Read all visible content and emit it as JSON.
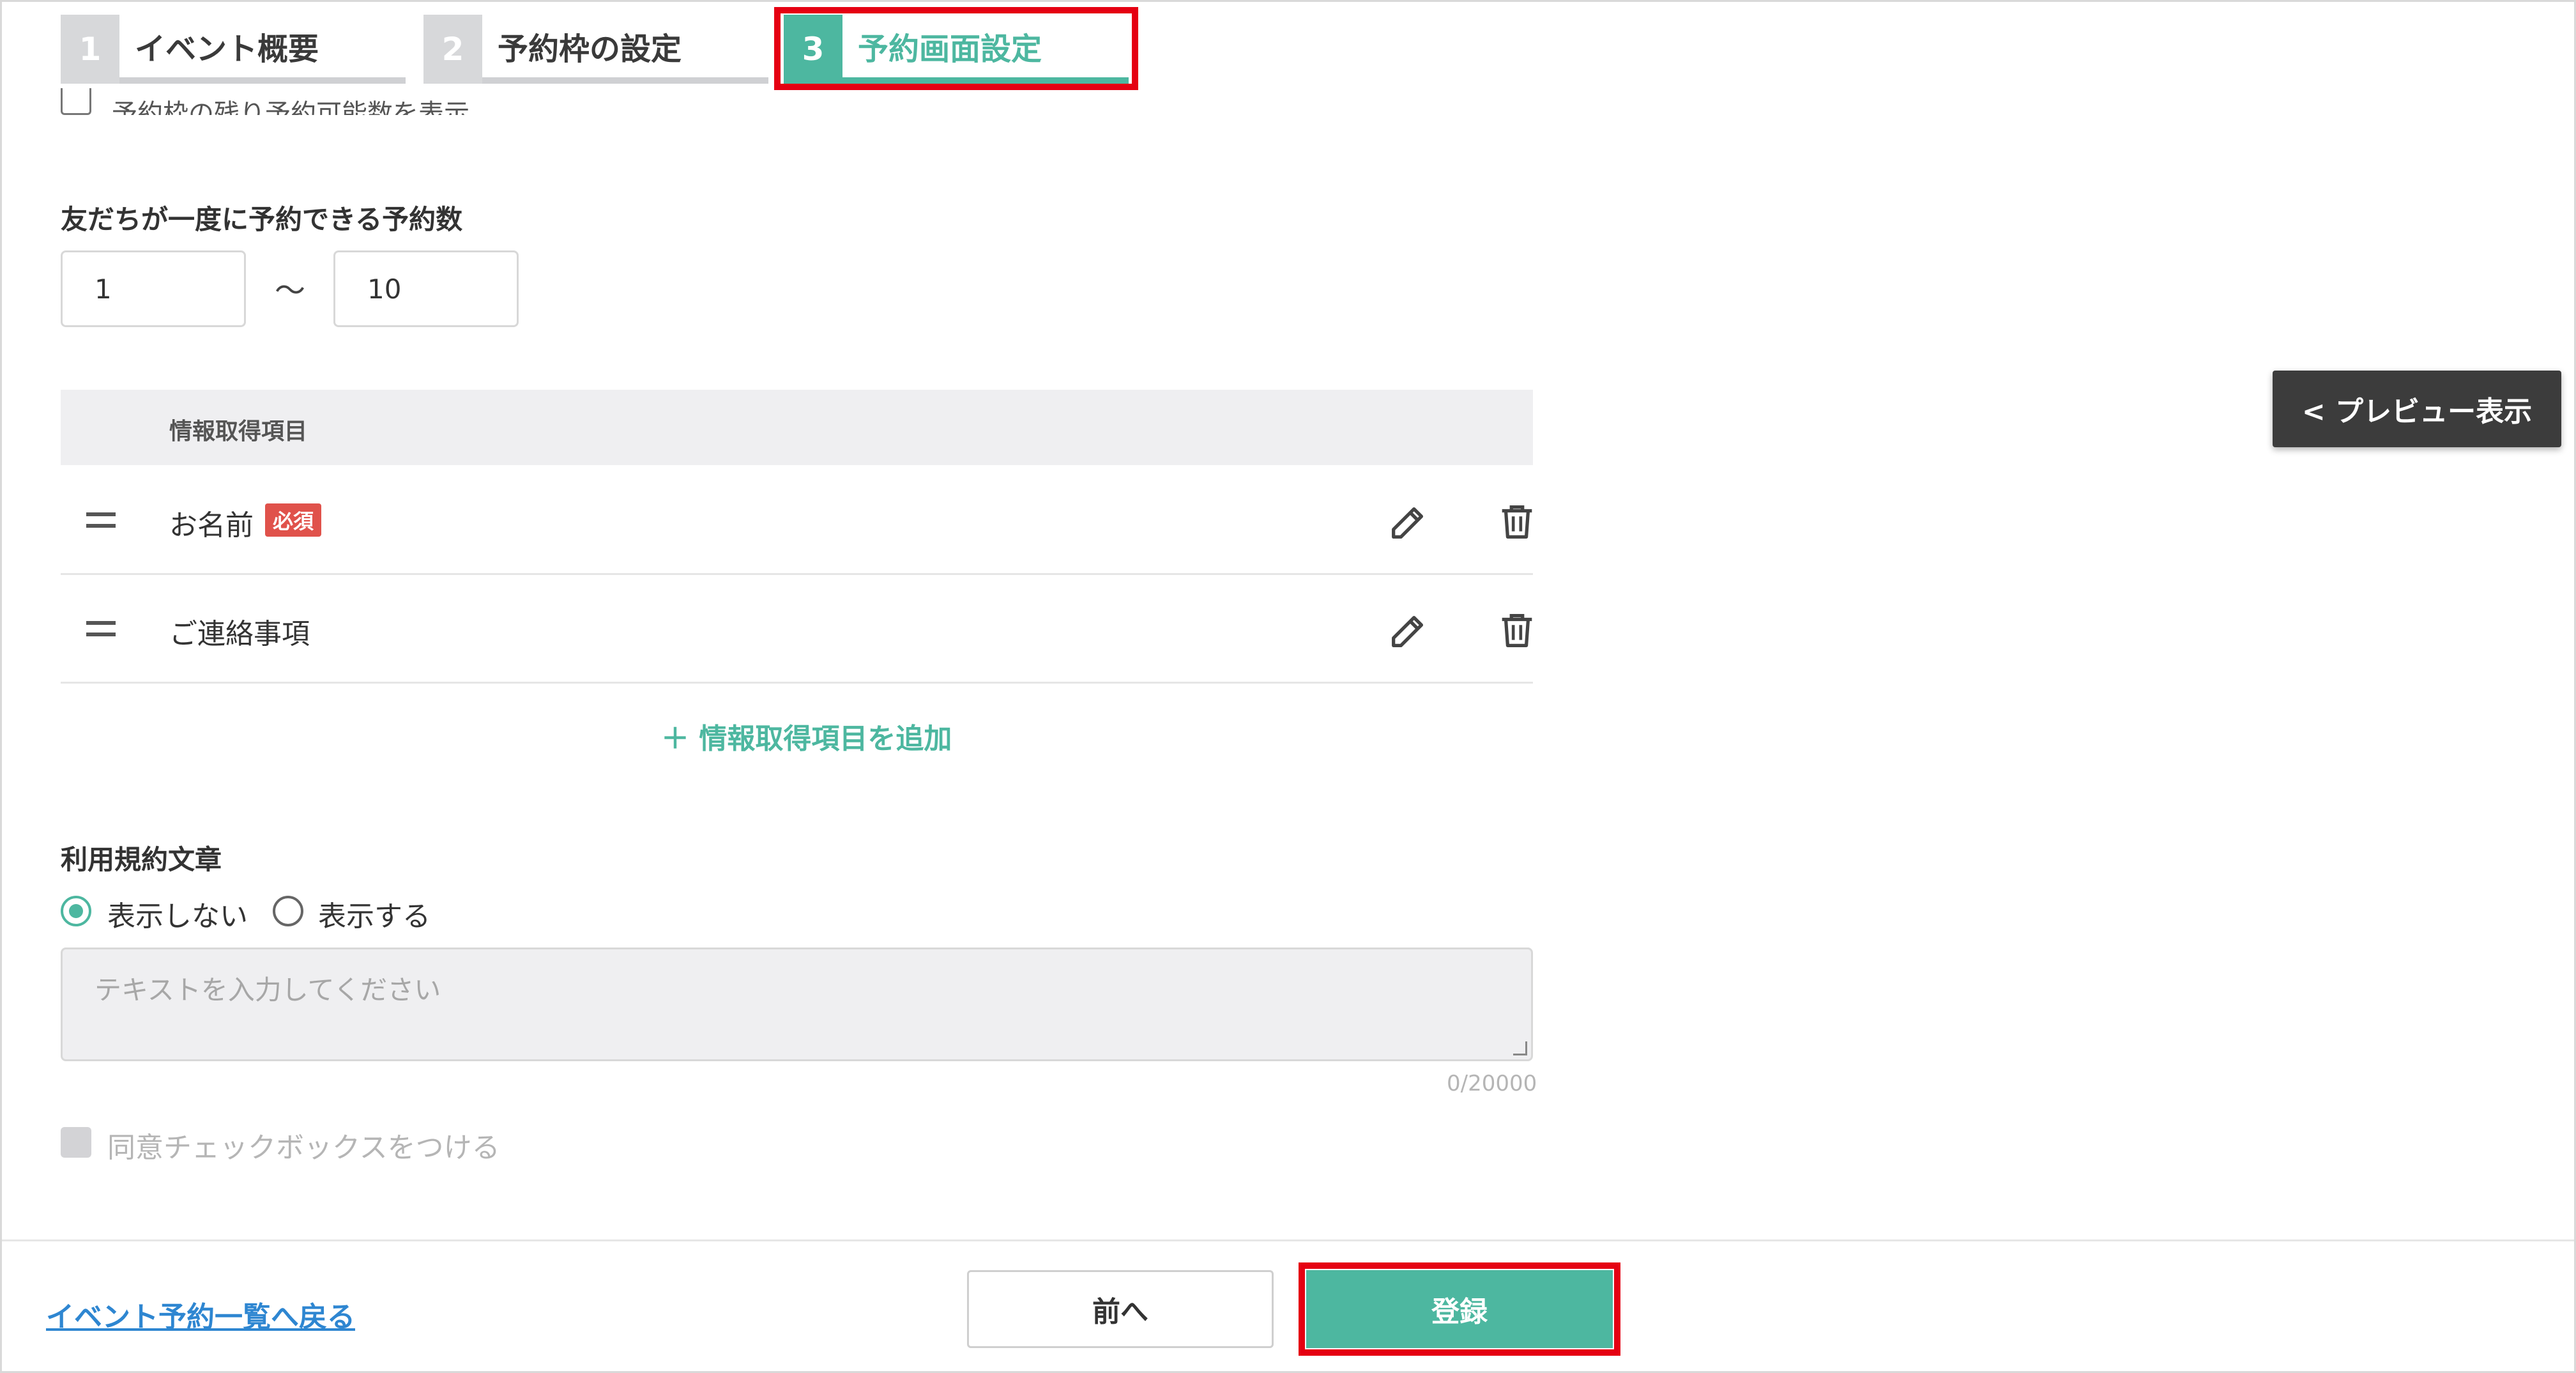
{
  "steps": [
    {
      "num": "1",
      "label": "イベント概要",
      "active": false
    },
    {
      "num": "2",
      "label": "予約枠の設定",
      "active": false
    },
    {
      "num": "3",
      "label": "予約画面設定",
      "active": true
    }
  ],
  "clipped_option": "予約枠の残り予約可能数を表示",
  "booking_count": {
    "label": "友だちが一度に予約できる予約数",
    "min": "1",
    "separator": "〜",
    "max": "10"
  },
  "info_table": {
    "header": "情報取得項目",
    "rows": [
      {
        "label": "お名前",
        "badge": "必須"
      },
      {
        "label": "ご連絡事項",
        "badge": ""
      }
    ],
    "add_label": "＋ 情報取得項目を追加"
  },
  "terms": {
    "label": "利用規約文章",
    "options": [
      "表示しない",
      "表示する"
    ],
    "selected": "表示しない",
    "placeholder": "テキストを入力してください",
    "counter": "0/20000",
    "agree_label": "同意チェックボックスをつける"
  },
  "preview_label": "< プレビュー表示",
  "footer": {
    "back_link": "イベント予約一覧へ戻る",
    "prev_label": "前へ",
    "register_label": "登録"
  },
  "colors": {
    "accent": "#4db7a0",
    "highlight": "#e50012",
    "required": "#e0524b",
    "link": "#2e86d1"
  }
}
